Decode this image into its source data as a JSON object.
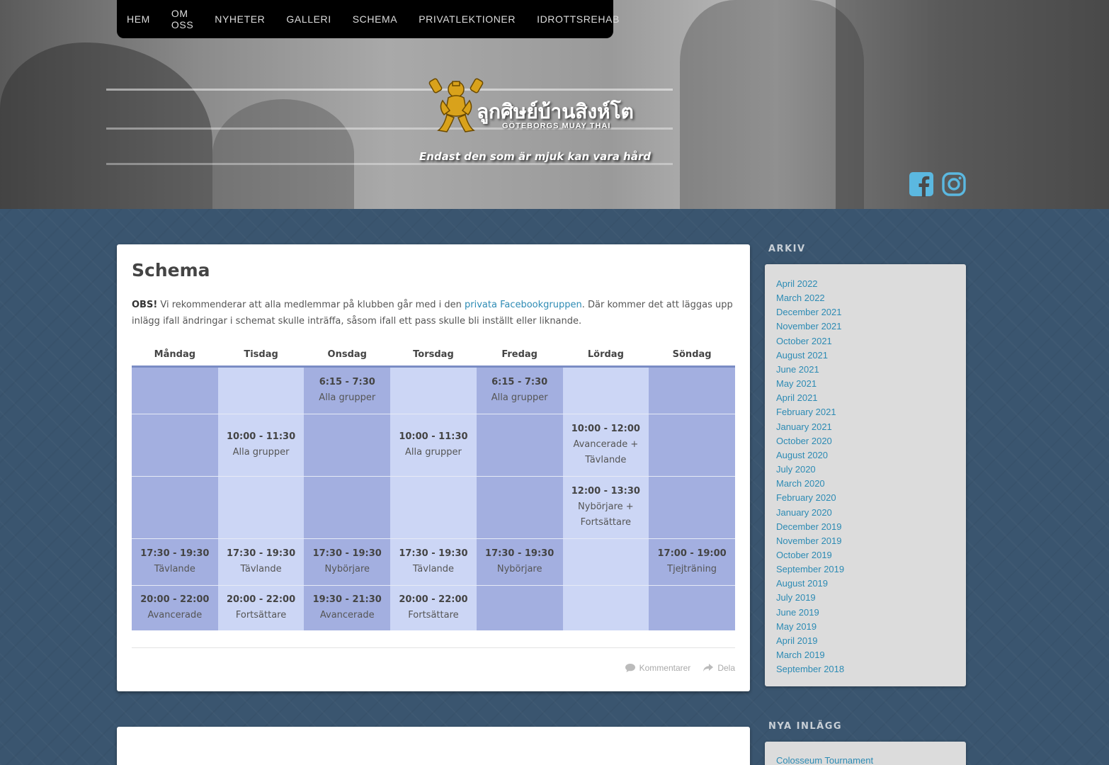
{
  "nav": {
    "items": [
      "HEM",
      "OM OSS",
      "NYHETER",
      "GALLERI",
      "SCHEMA",
      "PRIVATLEKTIONER",
      "IDROTTSREHAB"
    ]
  },
  "header": {
    "logo_thai": "ลูกศิษย์บ้านสิงห์โต",
    "logo_sub": "GÖTEBORGS MUAY THAI",
    "tagline": "Endast den som är mjuk kan vara hård",
    "social": [
      {
        "icon": "facebook-icon",
        "color": "#5bb8e0"
      },
      {
        "icon": "instagram-icon",
        "color": "#5bb8e0"
      }
    ]
  },
  "post": {
    "title": "Schema",
    "intro_bold": "OBS!",
    "intro_pre": " Vi rekommenderar att alla medlemmar på klubben går med i den ",
    "intro_link": "privata Facebookgruppen",
    "intro_post": ". Där kommer det att läggas upp inlägg ifall ändringar i schemat skulle inträffa, såsom ifall ett pass skulle bli inställt eller liknande.",
    "footer_comments": "Kommentarer",
    "footer_share": "Dela"
  },
  "schedule": {
    "days": [
      "Måndag",
      "Tisdag",
      "Onsdag",
      "Torsdag",
      "Fredag",
      "Lördag",
      "Söndag"
    ],
    "rows": [
      [
        {
          "time": "",
          "group": ""
        },
        {
          "time": "",
          "group": ""
        },
        {
          "time": "6:15 - 7:30",
          "group": "Alla grupper"
        },
        {
          "time": "",
          "group": ""
        },
        {
          "time": "6:15 - 7:30",
          "group": "Alla grupper"
        },
        {
          "time": "",
          "group": ""
        },
        {
          "time": "",
          "group": ""
        }
      ],
      [
        {
          "time": "",
          "group": ""
        },
        {
          "time": "10:00 - 11:30",
          "group": "Alla grupper"
        },
        {
          "time": "",
          "group": ""
        },
        {
          "time": "10:00 - 11:30",
          "group": "Alla grupper"
        },
        {
          "time": "",
          "group": ""
        },
        {
          "time": "10:00 - 12:00",
          "group": "Avancerade + Tävlande"
        },
        {
          "time": "",
          "group": ""
        }
      ],
      [
        {
          "time": "",
          "group": ""
        },
        {
          "time": "",
          "group": ""
        },
        {
          "time": "",
          "group": ""
        },
        {
          "time": "",
          "group": ""
        },
        {
          "time": "",
          "group": ""
        },
        {
          "time": "12:00 - 13:30",
          "group": "Nybörjare + Fortsättare"
        },
        {
          "time": "",
          "group": ""
        }
      ],
      [
        {
          "time": "17:30 - 19:30",
          "group": "Tävlande"
        },
        {
          "time": "17:30 - 19:30",
          "group": "Tävlande"
        },
        {
          "time": "17:30 - 19:30",
          "group": "Nybörjare"
        },
        {
          "time": "17:30 - 19:30",
          "group": "Tävlande"
        },
        {
          "time": "17:30 - 19:30",
          "group": "Nybörjare"
        },
        {
          "time": "",
          "group": ""
        },
        {
          "time": "17:00 - 19:00",
          "group": "Tjejträning"
        }
      ],
      [
        {
          "time": "20:00 - 22:00",
          "group": "Avancerade"
        },
        {
          "time": "20:00 - 22:00",
          "group": "Fortsättare"
        },
        {
          "time": "19:30 - 21:30",
          "group": "Avancerade"
        },
        {
          "time": "20:00 - 22:00",
          "group": "Fortsättare"
        },
        {
          "time": "",
          "group": ""
        },
        {
          "time": "",
          "group": ""
        },
        {
          "time": "",
          "group": ""
        }
      ]
    ],
    "colors": {
      "dark": "#a3afe0",
      "light": "#ccd6f5"
    }
  },
  "sidebar": {
    "archive_title": "ARKIV",
    "archive": [
      "April 2022",
      "March 2022",
      "December 2021",
      "November 2021",
      "October 2021",
      "August 2021",
      "June 2021",
      "May 2021",
      "April 2021",
      "February 2021",
      "January 2021",
      "October 2020",
      "August 2020",
      "July 2020",
      "March 2020",
      "February 2020",
      "January 2020",
      "December 2019",
      "November 2019",
      "October 2019",
      "September 2019",
      "August 2019",
      "July 2019",
      "June 2019",
      "May 2019",
      "April 2019",
      "March 2019",
      "September 2018"
    ],
    "recent_title": "NYA INLÄGG",
    "recent": [
      "Colosseum Tournament"
    ]
  }
}
